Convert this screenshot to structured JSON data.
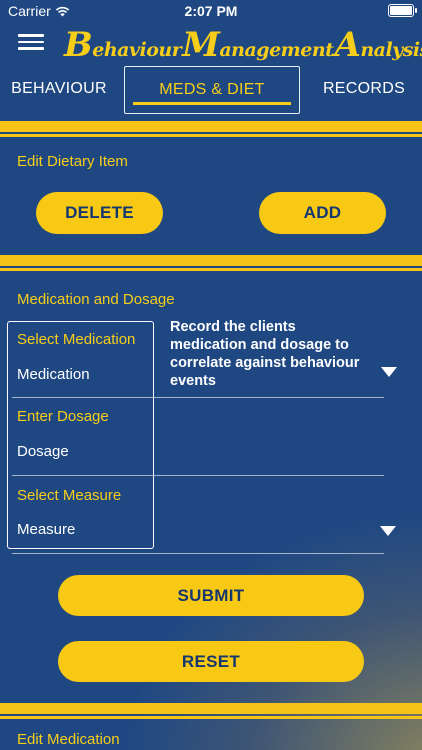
{
  "status_bar": {
    "carrier": "Carrier",
    "time": "2:07 PM"
  },
  "header": {
    "title_parts": [
      {
        "big": "B",
        "small": "ehaviour"
      },
      {
        "big": "M",
        "small": "anagement"
      },
      {
        "big": "A",
        "small": "nalysis"
      }
    ],
    "accent_color": "#f6cd18"
  },
  "tabs": [
    {
      "label": "BEHAVIOUR",
      "active": false
    },
    {
      "label": "MEDS & DIET",
      "active": true
    },
    {
      "label": "RECORDS",
      "active": false
    }
  ],
  "dietary": {
    "section_title": "Edit Dietary Item",
    "delete_label": "DELETE",
    "add_label": "ADD"
  },
  "medication": {
    "section_title": "Medication and Dosage",
    "info_text": "Record the clients medication and dosage to correlate against behaviour events",
    "select_medication_label": "Select Medication",
    "medication_value": "Medication",
    "enter_dosage_label": "Enter Dosage",
    "dosage_value": "Dosage",
    "select_measure_label": "Select Measure",
    "measure_value": "Measure",
    "submit_label": "SUBMIT",
    "reset_label": "RESET"
  },
  "edit_medication": {
    "section_title": "Edit Medication"
  }
}
